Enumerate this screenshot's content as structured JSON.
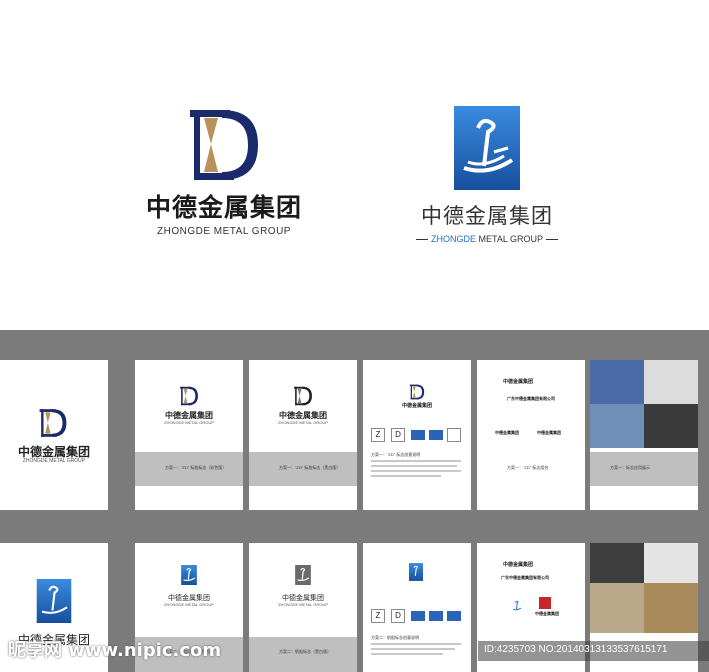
{
  "hero": {
    "logo_a": {
      "cn": "中德金属集团",
      "en": "ZHONGDE METAL GROUP"
    },
    "logo_b": {
      "cn": "中德金属集团",
      "en_accent": "ZHONGDE",
      "en_rest": " METAL GROUP"
    }
  },
  "thumbnails": {
    "row1": {
      "p1": {
        "cn": "中德金属集团",
        "en": "ZHONGDE METAL GROUP"
      },
      "p2": {
        "cn": "中德金属集团",
        "en": "ZHONGDE METAL GROUP",
        "caption": "方案一：\"ZD\" 标准标志（彩色版）"
      },
      "p3": {
        "cn": "中德金属集团",
        "en": "ZHONGDE METAL GROUP",
        "caption": "方案一：\"ZD\" 标准标志（黑白版）"
      },
      "p4": {
        "cn": "中德金属集团",
        "tiles": [
          "Z",
          "D"
        ],
        "caption": "方案一：\"ZD\" 标志创意说明"
      },
      "p5": {
        "cn1": "中德金属集团",
        "cn2": "广东中德金属集团有限公司",
        "cn3": "中德金属集团",
        "cn4": "中德金属集团",
        "caption": "方案一：\"ZD\" 标志组合"
      },
      "p6": {
        "caption": "方案一：标志应用展示"
      }
    },
    "row2": {
      "p1": {
        "cn": "中德金属集团"
      },
      "p2": {
        "cn": "中德金属集团",
        "en": "ZHONGDE METAL GROUP",
        "caption": "方案二：帆船标志（彩色版）"
      },
      "p3": {
        "cn": "中德金属集团",
        "en": "ZHONGDE METAL GROUP",
        "caption": "方案二：帆船标志（黑白版）"
      },
      "p4": {
        "tiles": [
          "Z",
          "D"
        ],
        "caption": "方案二：帆船标志创意说明"
      },
      "p5": {
        "cn1": "中德金属集团",
        "cn2": "广东中德金属集团有限公司",
        "cn3": "中德金属集团"
      },
      "p6": {}
    }
  },
  "watermark": "昵享网 www.nipic.com",
  "image_id": "ID:4235703 NO:20140313133537615171",
  "colors": {
    "navy": "#1b2a6b",
    "gold": "#b8925a",
    "blue": "#1f6fc4",
    "gray_bg": "#7b7b7b",
    "band": "#bfbfbf"
  }
}
